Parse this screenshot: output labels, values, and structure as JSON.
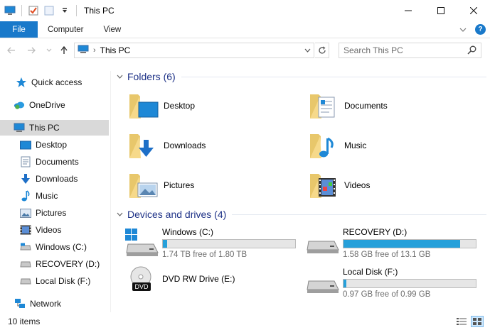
{
  "window": {
    "title": "This PC"
  },
  "ribbon": {
    "file_label": "File",
    "tabs": [
      {
        "label": "Computer"
      },
      {
        "label": "View"
      }
    ]
  },
  "address": {
    "path": "This PC"
  },
  "search": {
    "placeholder": "Search This PC"
  },
  "nav": {
    "items": [
      {
        "label": "Quick access"
      },
      {
        "label": "OneDrive"
      },
      {
        "label": "This PC"
      },
      {
        "label": "Desktop"
      },
      {
        "label": "Documents"
      },
      {
        "label": "Downloads"
      },
      {
        "label": "Music"
      },
      {
        "label": "Pictures"
      },
      {
        "label": "Videos"
      },
      {
        "label": "Windows (C:)"
      },
      {
        "label": "RECOVERY (D:)"
      },
      {
        "label": "Local Disk (F:)"
      },
      {
        "label": "Network"
      }
    ]
  },
  "folders": {
    "header": "Folders (6)",
    "items": [
      {
        "label": "Desktop"
      },
      {
        "label": "Documents"
      },
      {
        "label": "Downloads"
      },
      {
        "label": "Music"
      },
      {
        "label": "Pictures"
      },
      {
        "label": "Videos"
      }
    ]
  },
  "drives": {
    "header": "Devices and drives (4)",
    "items": [
      {
        "label": "Windows (C:)",
        "free": "1.74 TB free of 1.80 TB",
        "used_fraction": 0.033
      },
      {
        "label": "RECOVERY (D:)",
        "free": "1.58 GB free of 13.1 GB",
        "used_fraction": 0.88
      },
      {
        "label": "DVD RW Drive (E:)",
        "badge": "DVD"
      },
      {
        "label": "Local Disk (F:)",
        "free": "0.97 GB free of 0.99 GB",
        "used_fraction": 0.02
      }
    ]
  },
  "status": {
    "count": "10 items"
  },
  "colors": {
    "accent": "#1979ca",
    "bar_fill": "#26a0da",
    "header_text": "#1e3287"
  }
}
